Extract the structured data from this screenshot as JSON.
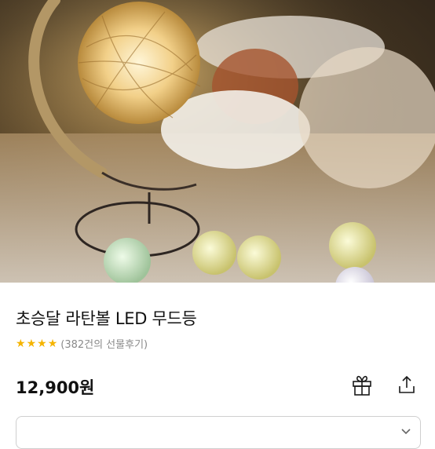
{
  "product": {
    "title": "초승달 라탄볼 LED 무드등",
    "rating_stars": 4,
    "review_text": "(382건의 선물후기)",
    "price": "12,900원"
  },
  "icons": {
    "gift": "gift-icon",
    "share": "share-icon",
    "star": "star-icon"
  },
  "colors": {
    "star": "#f5b400",
    "review_text": "#8a8a8a",
    "title": "#111111"
  }
}
